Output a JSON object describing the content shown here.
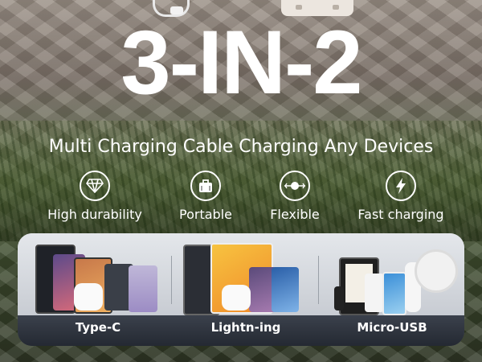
{
  "headline": "3-IN-2",
  "subtitle": "Multi Charging Cable Charging Any Devices",
  "features": [
    {
      "label": "High durability",
      "icon": "diamond-icon"
    },
    {
      "label": "Portable",
      "icon": "briefcase-icon"
    },
    {
      "label": "Flexible",
      "icon": "cable-dot-icon"
    },
    {
      "label": "Fast charging",
      "icon": "lightning-icon"
    }
  ],
  "connectors": [
    {
      "label": "Type-C"
    },
    {
      "label": "Lightn-ing"
    },
    {
      "label": "Micro-USB"
    }
  ],
  "colors": {
    "text": "#ffffff",
    "panel_dark": "#2a2f38",
    "panel_light": "#e4e7eb"
  }
}
